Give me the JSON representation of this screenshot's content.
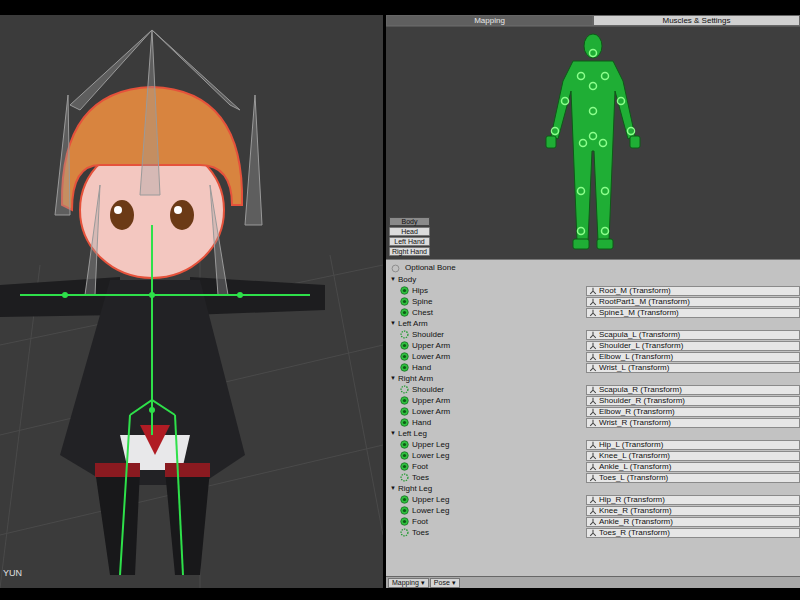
{
  "viewport": {
    "label": "YUN"
  },
  "tabs": [
    {
      "label": "Mapping",
      "selected": true
    },
    {
      "label": "Muscles & Settings",
      "selected": false
    }
  ],
  "view_buttons": [
    {
      "label": "Body",
      "selected": true
    },
    {
      "label": "Head",
      "selected": false
    },
    {
      "label": "Left Hand",
      "selected": false
    },
    {
      "label": "Right Hand",
      "selected": false
    }
  ],
  "legend": {
    "label": "Optional Bone"
  },
  "groups": [
    {
      "name": "Body",
      "expander": "▼",
      "expanded": true,
      "bones": [
        {
          "name": "Hips",
          "transform": "Root_M (Transform)",
          "optional": false
        },
        {
          "name": "Spine",
          "transform": "RootPart1_M (Transform)",
          "optional": false
        },
        {
          "name": "Chest",
          "transform": "Spine1_M (Transform)",
          "optional": false
        }
      ]
    },
    {
      "name": "Left Arm",
      "expander": "▼",
      "expanded": true,
      "bones": [
        {
          "name": "Shoulder",
          "transform": "Scapula_L (Transform)",
          "optional": true
        },
        {
          "name": "Upper Arm",
          "transform": "Shoulder_L (Transform)",
          "optional": false
        },
        {
          "name": "Lower Arm",
          "transform": "Elbow_L (Transform)",
          "optional": false
        },
        {
          "name": "Hand",
          "transform": "Wrist_L (Transform)",
          "optional": false
        }
      ]
    },
    {
      "name": "Right Arm",
      "expander": "▼",
      "expanded": true,
      "bones": [
        {
          "name": "Shoulder",
          "transform": "Scapula_R (Transform)",
          "optional": true
        },
        {
          "name": "Upper Arm",
          "transform": "Shoulder_R (Transform)",
          "optional": false
        },
        {
          "name": "Lower Arm",
          "transform": "Elbow_R (Transform)",
          "optional": false
        },
        {
          "name": "Hand",
          "transform": "Wrist_R (Transform)",
          "optional": false
        }
      ]
    },
    {
      "name": "Left Leg",
      "expander": "▼",
      "expanded": true,
      "bones": [
        {
          "name": "Upper Leg",
          "transform": "Hip_L (Transform)",
          "optional": false
        },
        {
          "name": "Lower Leg",
          "transform": "Knee_L (Transform)",
          "optional": false
        },
        {
          "name": "Foot",
          "transform": "Ankle_L (Transform)",
          "optional": false
        },
        {
          "name": "Toes",
          "transform": "Toes_L (Transform)",
          "optional": true
        }
      ]
    },
    {
      "name": "Right Leg",
      "expander": "▼",
      "expanded": true,
      "bones": [
        {
          "name": "Upper Leg",
          "transform": "Hip_R (Transform)",
          "optional": false
        },
        {
          "name": "Lower Leg",
          "transform": "Knee_R (Transform)",
          "optional": false
        },
        {
          "name": "Foot",
          "transform": "Ankle_R (Transform)",
          "optional": false
        },
        {
          "name": "Toes",
          "transform": "Toes_R (Transform)",
          "optional": true
        }
      ]
    }
  ],
  "bottom_buttons": [
    {
      "label": "Mapping",
      "arrow": "▾"
    },
    {
      "label": "Pose",
      "arrow": "▾"
    }
  ]
}
